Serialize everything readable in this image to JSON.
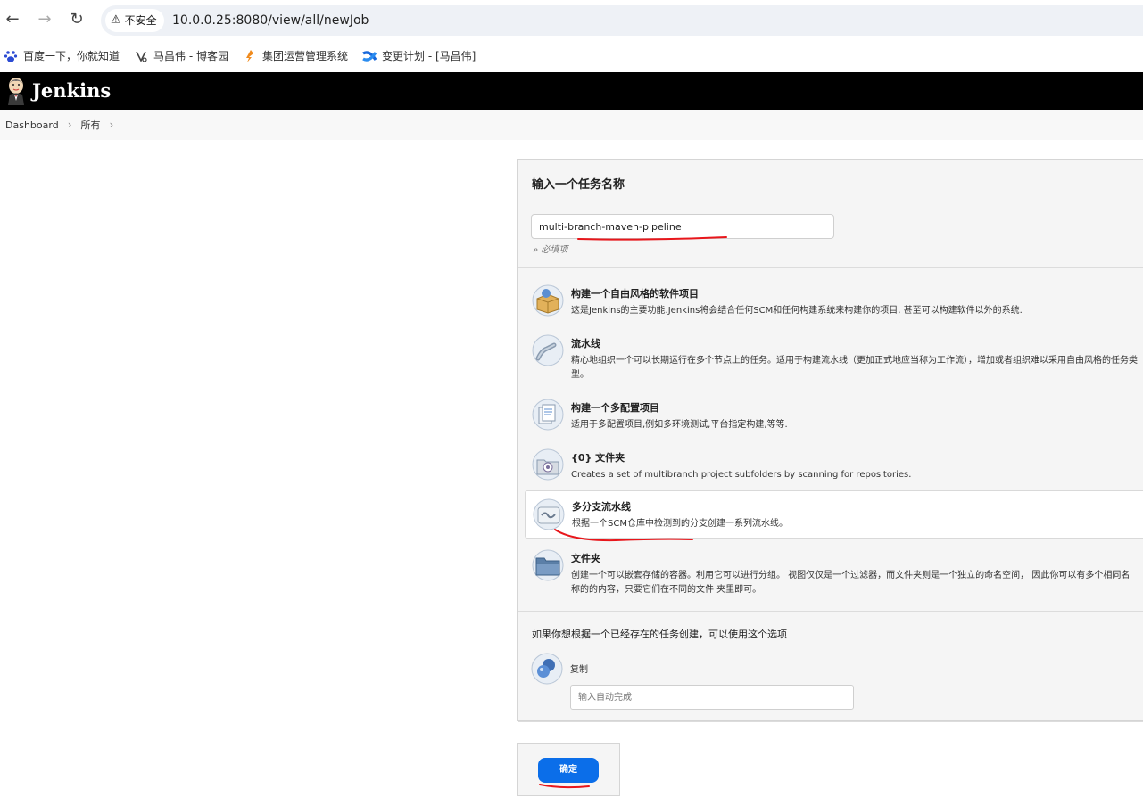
{
  "browser": {
    "security_label": "不安全",
    "url": "10.0.0.25:8080/view/all/newJob",
    "bookmarks": [
      {
        "label": "百度一下，你就知道",
        "icon": "baidu-paw-icon"
      },
      {
        "label": "马昌伟 - 博客园",
        "icon": "cnblogs-icon"
      },
      {
        "label": "集团运营管理系统",
        "icon": "ops-system-icon"
      },
      {
        "label": "变更计划 - [马昌伟]",
        "icon": "confluence-icon"
      }
    ]
  },
  "header": {
    "title": "Jenkins"
  },
  "breadcrumb": [
    "Dashboard",
    "所有"
  ],
  "name_section": {
    "title": "输入一个任务名称",
    "value": "multi-branch-maven-pipeline",
    "required_note": "» 必填项"
  },
  "job_types": [
    {
      "label": "构建一个自由风格的软件项目",
      "description": "这是Jenkins的主要功能.Jenkins将会结合任何SCM和任何构建系统来构建你的项目, 甚至可以构建软件以外的系统.",
      "icon": "freestyle-box-icon"
    },
    {
      "label": "流水线",
      "description": "精心地组织一个可以长期运行在多个节点上的任务。适用于构建流水线（更加正式地应当称为工作流），增加或者组织难以采用自由风格的任务类型。",
      "icon": "pipeline-icon"
    },
    {
      "label": "构建一个多配置项目",
      "description": "适用于多配置项目,例如多环境测试,平台指定构建,等等.",
      "icon": "multi-config-icon"
    },
    {
      "label": "{0} 文件夹",
      "description": "Creates a set of multibranch project subfolders by scanning for repositories.",
      "icon": "org-folder-icon"
    },
    {
      "label": "多分支流水线",
      "description": "根据一个SCM仓库中检测到的分支创建一系列流水线。",
      "icon": "multibranch-pipeline-icon",
      "selected": true
    },
    {
      "label": "文件夹",
      "description": "创建一个可以嵌套存储的容器。利用它可以进行分组。 视图仅仅是一个过滤器，而文件夹则是一个独立的命名空间， 因此你可以有多个相同名称的的内容，只要它们在不同的文件 夹里即可。",
      "icon": "folder-icon"
    }
  ],
  "copy_section": {
    "title": "如果你想根据一个已经存在的任务创建，可以使用这个选项",
    "label": "复制",
    "placeholder": "输入自动完成",
    "icon": "copy-icon"
  },
  "ok_button": "确定",
  "annotation_color": "#e8161b"
}
